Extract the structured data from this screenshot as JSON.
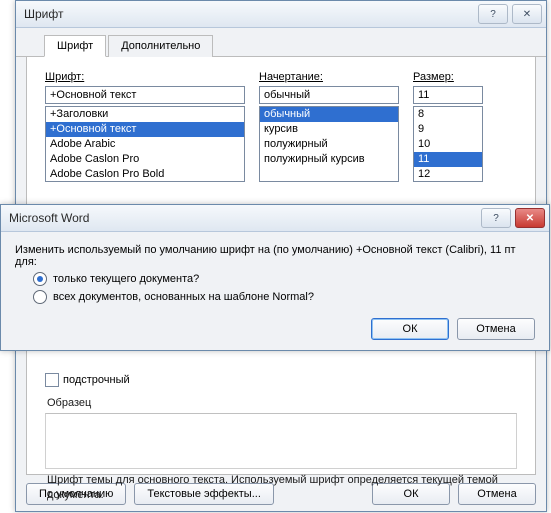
{
  "font_dialog": {
    "title": "Шрифт",
    "help_icon": "?",
    "close_icon": "✕",
    "tabs": {
      "font": "Шрифт",
      "advanced": "Дополнительно"
    },
    "labels": {
      "font": "Шрифт:",
      "style": "Начертание:",
      "size": "Размер:"
    },
    "font_value": "+Основной текст",
    "style_value": "обычный",
    "size_value": "11",
    "font_list": [
      "+Заголовки",
      "+Основной текст",
      "Adobe Arabic",
      "Adobe Caslon Pro",
      "Adobe Caslon Pro Bold"
    ],
    "font_selected_index": 1,
    "style_list": [
      "обычный",
      "курсив",
      "полужирный",
      "полужирный курсив"
    ],
    "style_selected_index": 0,
    "size_list": [
      "8",
      "9",
      "10",
      "11",
      "12"
    ],
    "size_selected_index": 3,
    "subscript_label": "подстрочный",
    "sample_label": "Образец",
    "description": "Шрифт темы для основного текста. Используемый шрифт определяется текущей темой документа.",
    "buttons": {
      "default": "По умолчанию",
      "text_effects": "Текстовые эффекты...",
      "ok": "ОК",
      "cancel": "Отмена"
    }
  },
  "msg_box": {
    "title": "Microsoft Word",
    "help_icon": "?",
    "close_icon": "✕",
    "prompt": "Изменить используемый по умолчанию шрифт на (по умолчанию) +Основной текст (Calibri), 11 пт для:",
    "option_current": "только текущего документа?",
    "option_all": "всех документов, основанных на шаблоне Normal?",
    "buttons": {
      "ok": "ОК",
      "cancel": "Отмена"
    }
  }
}
